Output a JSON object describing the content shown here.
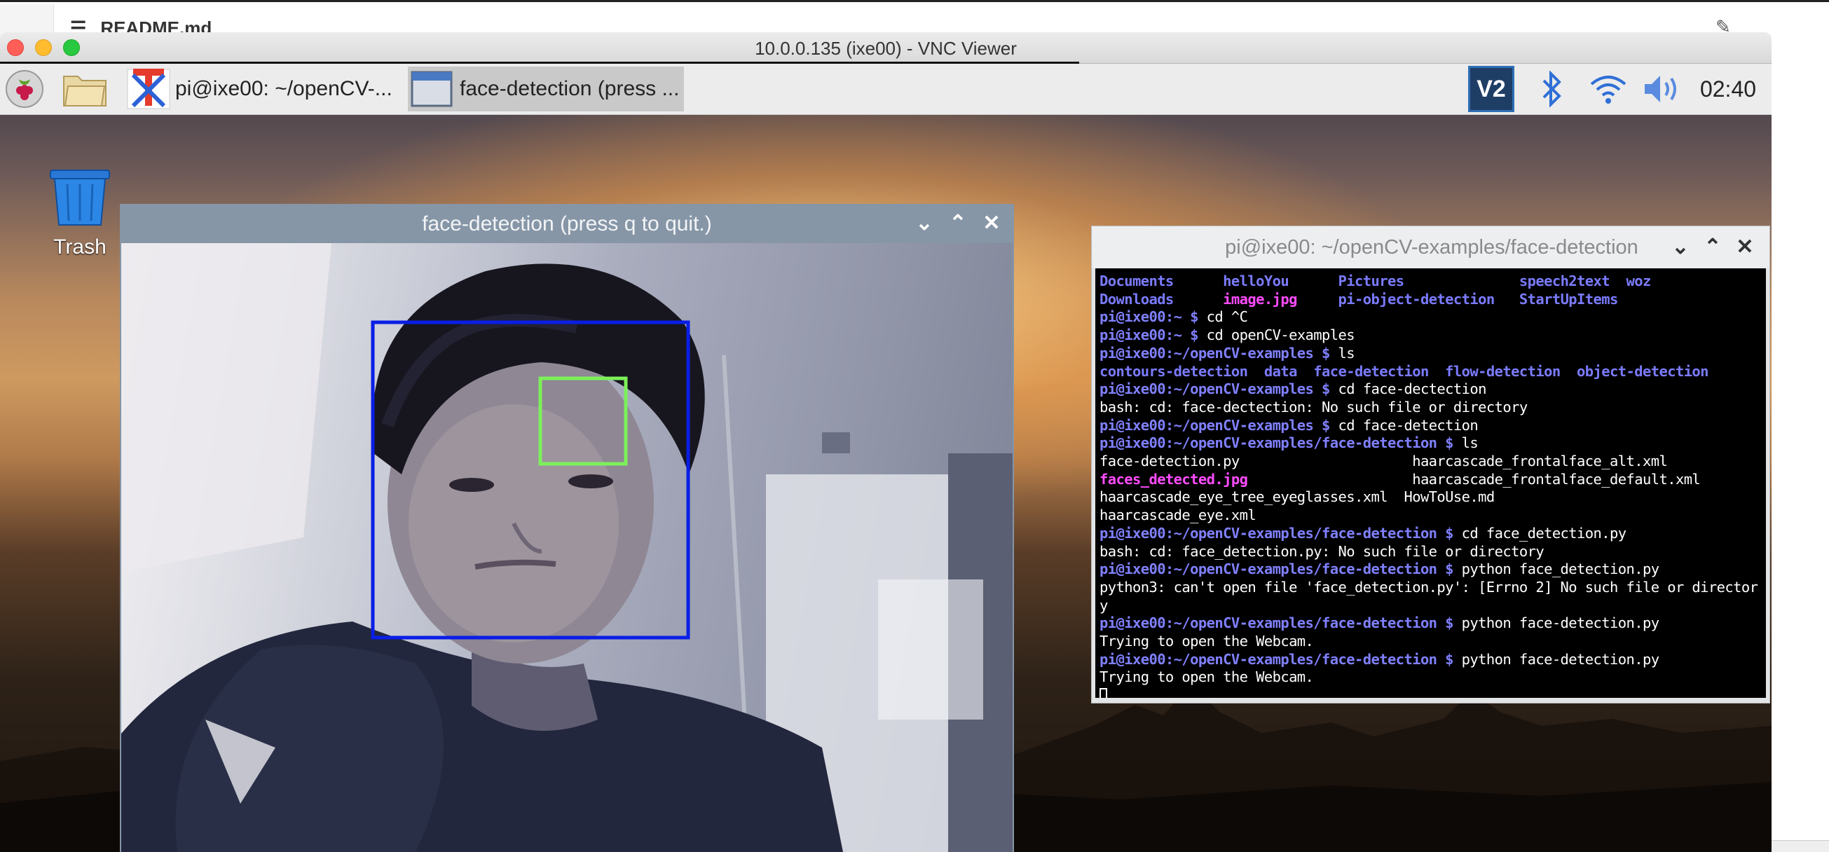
{
  "host": {
    "readme_label": "README.md"
  },
  "vnc": {
    "title": "10.0.0.135 (ixe00) - VNC Viewer",
    "traffic_colors": [
      "#ff5f57",
      "#febc2e",
      "#28c840"
    ]
  },
  "panel": {
    "tasks": [
      {
        "label": "pi@ixe00: ~/openCV-..."
      },
      {
        "label": "face-detection (press ..."
      }
    ],
    "clock": "02:40",
    "vnc_badge": "V2"
  },
  "desktop": {
    "trash_label": "Trash"
  },
  "face_window": {
    "title": "face-detection (press q to quit.)",
    "face_box_color": "#0a1ee6",
    "eye_box_color": "#7cf05a"
  },
  "terminal": {
    "title": "pi@ixe00: ~/openCV-examples/face-detection",
    "prompt_user": "pi@ixe00",
    "lines": [
      [
        [
          "d",
          "Documents      "
        ],
        [
          "d",
          "helloYou      "
        ],
        [
          "d",
          "Pictures              "
        ],
        [
          "d",
          "speech2text  "
        ],
        [
          "d",
          "woz"
        ]
      ],
      [
        [
          "d",
          "Downloads      "
        ],
        [
          "m",
          "image.jpg     "
        ],
        [
          "d",
          "pi-object-detection   "
        ],
        [
          "d",
          "StartUpItems"
        ]
      ],
      [
        [
          "p",
          "pi@ixe00:~ $ "
        ],
        [
          "t",
          "cd ^C"
        ]
      ],
      [
        [
          "p",
          "pi@ixe00:~ $ "
        ],
        [
          "t",
          "cd openCV-examples"
        ]
      ],
      [
        [
          "p",
          "pi@ixe00:~/openCV-examples $ "
        ],
        [
          "t",
          "ls"
        ]
      ],
      [
        [
          "d",
          "contours-detection  "
        ],
        [
          "d",
          "data  "
        ],
        [
          "d",
          "face-detection  "
        ],
        [
          "d",
          "flow-detection  "
        ],
        [
          "d",
          "object-detection"
        ]
      ],
      [
        [
          "p",
          "pi@ixe00:~/openCV-examples $ "
        ],
        [
          "t",
          "cd face-dectection"
        ]
      ],
      [
        [
          "t",
          "bash: cd: face-dectection: No such file or directory"
        ]
      ],
      [
        [
          "p",
          "pi@ixe00:~/openCV-examples $ "
        ],
        [
          "t",
          "cd face-detection"
        ]
      ],
      [
        [
          "p",
          "pi@ixe00:~/openCV-examples/face-detection $ "
        ],
        [
          "t",
          "ls"
        ]
      ],
      [
        [
          "t",
          "face-detection.py                     haarcascade_frontalface_alt.xml"
        ]
      ],
      [
        [
          "m",
          "faces_detected.jpg"
        ],
        [
          "t",
          "                    haarcascade_frontalface_default.xml"
        ]
      ],
      [
        [
          "t",
          "haarcascade_eye_tree_eyeglasses.xml  HowToUse.md"
        ]
      ],
      [
        [
          "t",
          "haarcascade_eye.xml"
        ]
      ],
      [
        [
          "p",
          "pi@ixe00:~/openCV-examples/face-detection $ "
        ],
        [
          "t",
          "cd face_detection.py"
        ]
      ],
      [
        [
          "t",
          "bash: cd: face_detection.py: No such file or directory"
        ]
      ],
      [
        [
          "p",
          "pi@ixe00:~/openCV-examples/face-detection $ "
        ],
        [
          "t",
          "python face_detection.py"
        ]
      ],
      [
        [
          "t",
          "python3: can't open file 'face_detection.py': [Errno 2] No such file or director"
        ]
      ],
      [
        [
          "t",
          "y"
        ]
      ],
      [
        [
          "p",
          "pi@ixe00:~/openCV-examples/face-detection $ "
        ],
        [
          "t",
          "python face-detection.py"
        ]
      ],
      [
        [
          "t",
          "Trying to open the Webcam."
        ]
      ],
      [
        [
          "p",
          "pi@ixe00:~/openCV-examples/face-detection $ "
        ],
        [
          "t",
          "python face-detection.py"
        ]
      ],
      [
        [
          "t",
          "Trying to open the Webcam."
        ]
      ]
    ]
  }
}
